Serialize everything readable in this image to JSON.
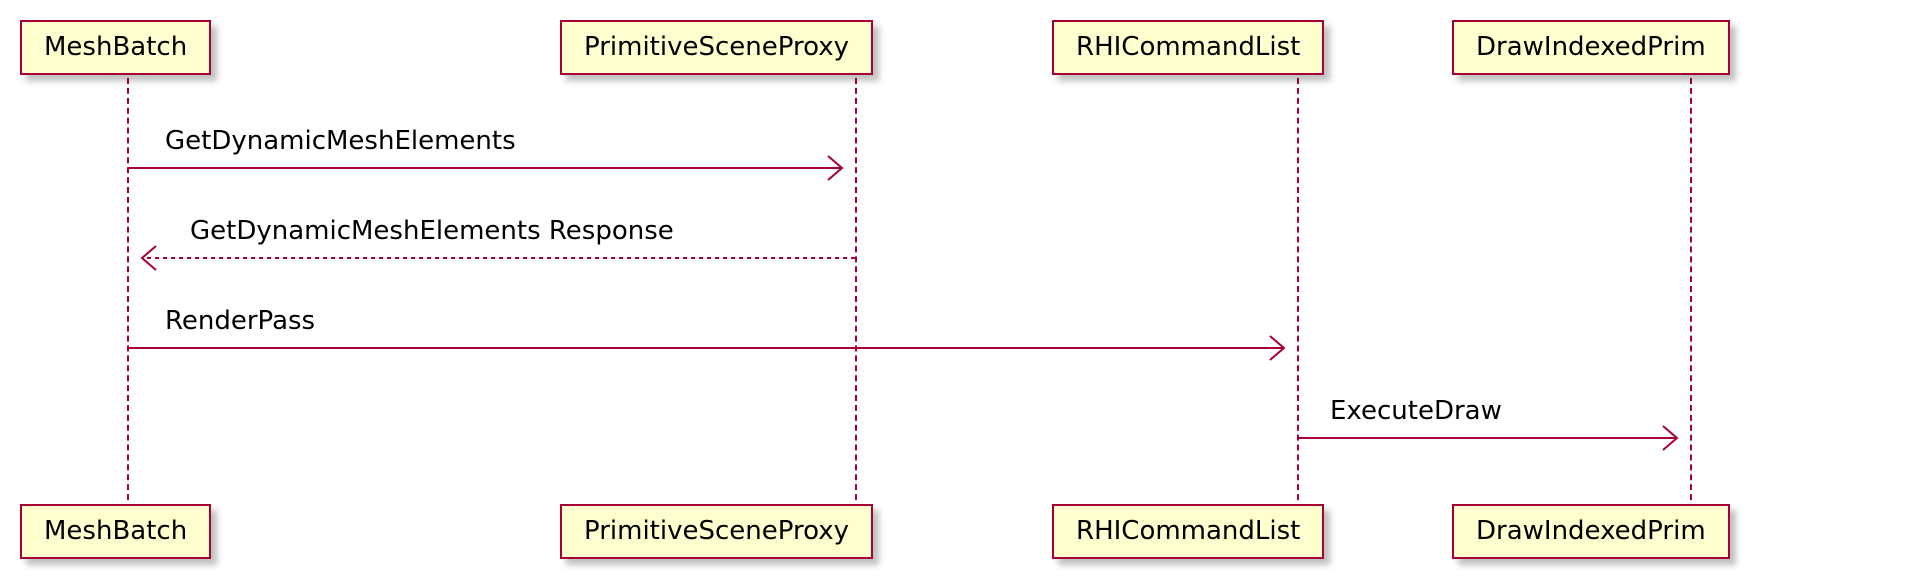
{
  "participants": {
    "p1": {
      "name": "MeshBatch"
    },
    "p2": {
      "name": "PrimitiveSceneProxy"
    },
    "p3": {
      "name": "RHICommandList"
    },
    "p4": {
      "name": "DrawIndexedPrim"
    }
  },
  "messages": {
    "m1": {
      "label": "GetDynamicMeshElements"
    },
    "m2": {
      "label": "GetDynamicMeshElements Response"
    },
    "m3": {
      "label": "RenderPass"
    },
    "m4": {
      "label": "ExecuteDraw"
    }
  },
  "chart_data": {
    "type": "sequence-diagram",
    "participants": [
      "MeshBatch",
      "PrimitiveSceneProxy",
      "RHICommandList",
      "DrawIndexedPrim"
    ],
    "messages": [
      {
        "from": "MeshBatch",
        "to": "PrimitiveSceneProxy",
        "label": "GetDynamicMeshElements",
        "style": "solid",
        "direction": "right"
      },
      {
        "from": "PrimitiveSceneProxy",
        "to": "MeshBatch",
        "label": "GetDynamicMeshElements Response",
        "style": "dashed",
        "direction": "left"
      },
      {
        "from": "MeshBatch",
        "to": "RHICommandList",
        "label": "RenderPass",
        "style": "solid",
        "direction": "right"
      },
      {
        "from": "RHICommandList",
        "to": "DrawIndexedPrim",
        "label": "ExecuteDraw",
        "style": "solid",
        "direction": "right"
      }
    ]
  }
}
